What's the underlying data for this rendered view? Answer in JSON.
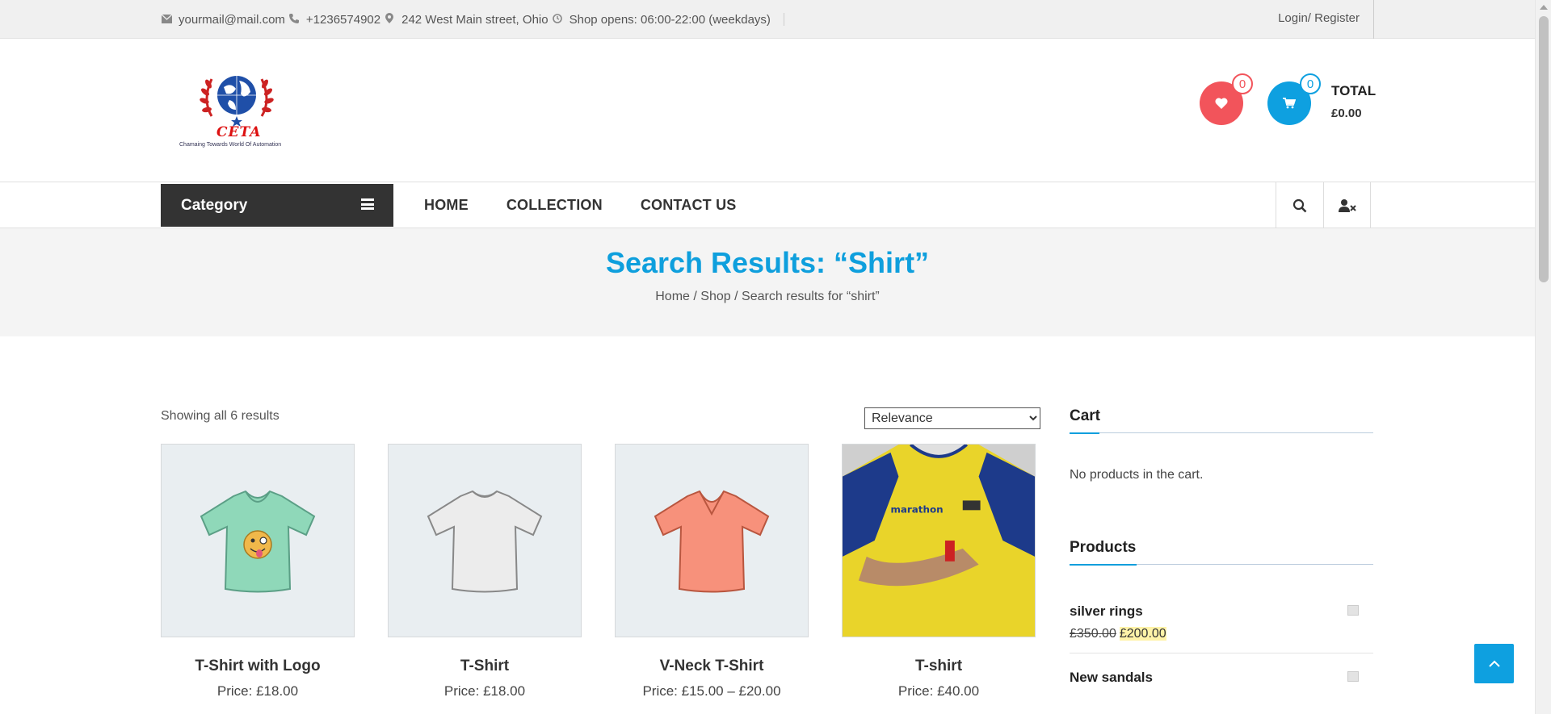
{
  "topbar": {
    "email": "yourmail@mail.com",
    "phone": "+1236574902",
    "address": "242 West Main street, Ohio",
    "hours": "Shop opens: 06:00-22:00 (weekdays)",
    "login": "Login/ Register"
  },
  "logo": {
    "brand": "CETA",
    "tagline": "Chamaing Towards World Of Automation"
  },
  "header": {
    "wishlist_count": "0",
    "cart_count": "0",
    "total_label": "TOTAL",
    "total_amount": "£0.00"
  },
  "nav": {
    "category_label": "Category",
    "items": [
      "HOME",
      "COLLECTION",
      "CONTACT US"
    ]
  },
  "banner": {
    "title": "Search Results: “Shirt”",
    "breadcrumb": [
      "Home",
      "Shop",
      "Search results for “shirt”"
    ],
    "separator": "/"
  },
  "results": {
    "count_text": "Showing all 6 results",
    "sort_selected": "Relevance"
  },
  "products": [
    {
      "name": "T-Shirt with Logo",
      "price": "Price:  £18.00",
      "image": "green-tshirt-logo"
    },
    {
      "name": "T-Shirt",
      "price": "Price:  £18.00",
      "image": "white-tshirt"
    },
    {
      "name": "V-Neck T-Shirt",
      "price": "Price:  £15.00 – £20.00",
      "image": "orange-vneck"
    },
    {
      "name": "T-shirt",
      "price": "Price:  £40.00",
      "image": "yellow-jersey-photo"
    }
  ],
  "sidebar": {
    "cart_title": "Cart",
    "cart_empty": "No products in the cart.",
    "products_title": "Products",
    "products": [
      {
        "name": "silver rings",
        "old_price": "£350.00",
        "new_price": "£200.00"
      },
      {
        "name": "New sandals",
        "old_price": "",
        "new_price": ""
      }
    ]
  },
  "colors": {
    "accent": "#0e9fdd",
    "wishlist": "#f2545b",
    "dark": "#333333"
  }
}
